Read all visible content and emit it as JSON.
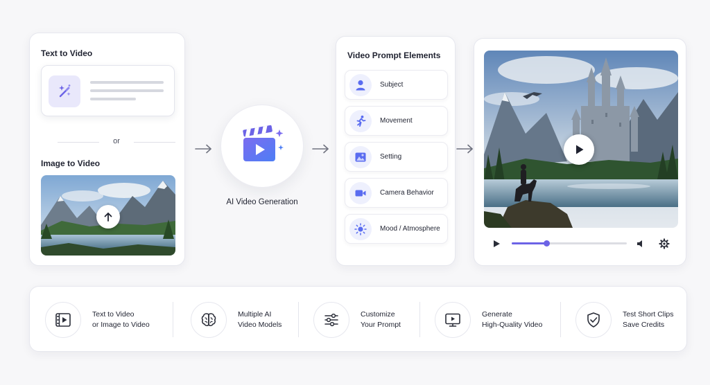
{
  "input_card": {
    "text_to_video_title": "Text to Video",
    "or_label": "or",
    "image_to_video_title": "Image to Video"
  },
  "ai": {
    "label": "AI Video Generation"
  },
  "prompt_elements": {
    "title": "Video Prompt Elements",
    "items": [
      {
        "label": "Subject",
        "icon": "person-icon"
      },
      {
        "label": "Movement",
        "icon": "running-icon"
      },
      {
        "label": "Setting",
        "icon": "image-icon"
      },
      {
        "label": "Camera Behavior",
        "icon": "video-camera-icon"
      },
      {
        "label": "Mood / Atmosphere",
        "icon": "sun-icon"
      }
    ]
  },
  "player": {
    "progress": 0.3
  },
  "features": [
    {
      "line1": "Text to Video",
      "line2": "or Image to Video",
      "icon": "film-icon"
    },
    {
      "line1": "Multiple AI",
      "line2": "Video Models",
      "icon": "brain-icon"
    },
    {
      "line1": "Customize",
      "line2": "Your Prompt",
      "icon": "sliders-icon"
    },
    {
      "line1": "Generate",
      "line2": "High-Quality Video",
      "icon": "monitor-play-icon"
    },
    {
      "line1": "Test Short Clips",
      "line2": "Save Credits",
      "icon": "shield-check-icon"
    }
  ],
  "colors": {
    "accent": "#6c63e6",
    "accent_light": "#eef0fd",
    "border": "#e6e7ee",
    "background": "#f7f7f9"
  }
}
